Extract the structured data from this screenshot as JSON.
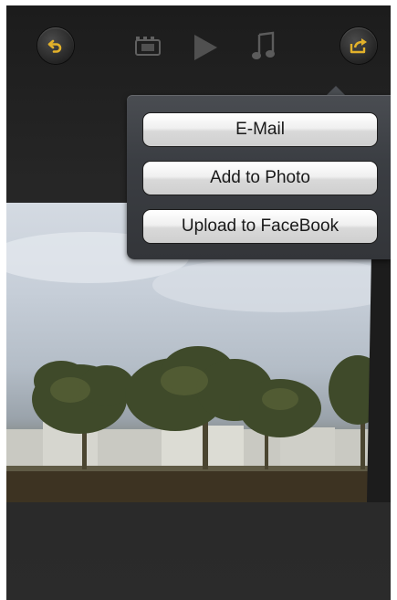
{
  "toolbar": {
    "back_icon": "undo-arrow-icon",
    "frames_icon": "filmstrip-icon",
    "play_icon": "play-icon",
    "music_icon": "music-note-icon",
    "share_icon": "share-export-icon",
    "accent_color": "#e2b12a"
  },
  "share_menu": {
    "items": [
      {
        "label": "E-Mail"
      },
      {
        "label": "Add to Photo"
      },
      {
        "label": "Upload to FaceBook"
      }
    ]
  }
}
